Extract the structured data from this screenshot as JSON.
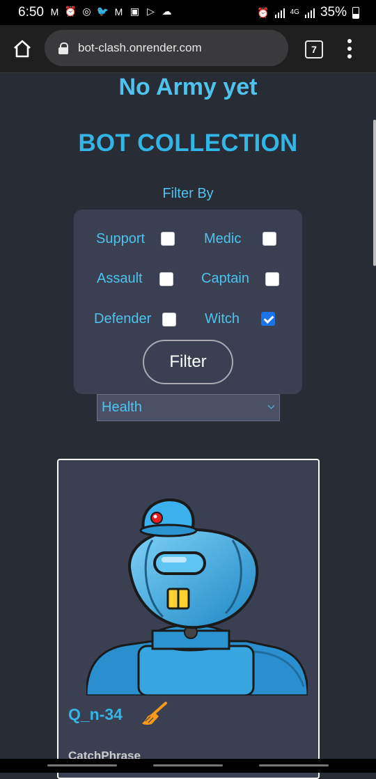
{
  "status_bar": {
    "time": "6:50",
    "network": "4G",
    "battery": "35%"
  },
  "browser": {
    "url": "bot-clash.onrender.com",
    "tab_count": "7"
  },
  "page": {
    "army_title": "No Army yet",
    "collection_title": "BOT COLLECTION",
    "filter_by": "Filter By",
    "filter_options": [
      {
        "label": "Support",
        "checked": false
      },
      {
        "label": "Medic",
        "checked": false
      },
      {
        "label": "Assault",
        "checked": false
      },
      {
        "label": "Captain",
        "checked": false
      },
      {
        "label": "Defender",
        "checked": false
      },
      {
        "label": "Witch",
        "checked": true
      }
    ],
    "filter_button": "Filter",
    "sort_select": {
      "value": "Health"
    },
    "bot_card": {
      "name": "Q_n-34",
      "class_icon": "broom-icon",
      "catchphrase_label": "CatchPhrase"
    }
  },
  "colors": {
    "background": "#282c34",
    "accent": "#33b5e5",
    "panel": "#3a3f51"
  }
}
